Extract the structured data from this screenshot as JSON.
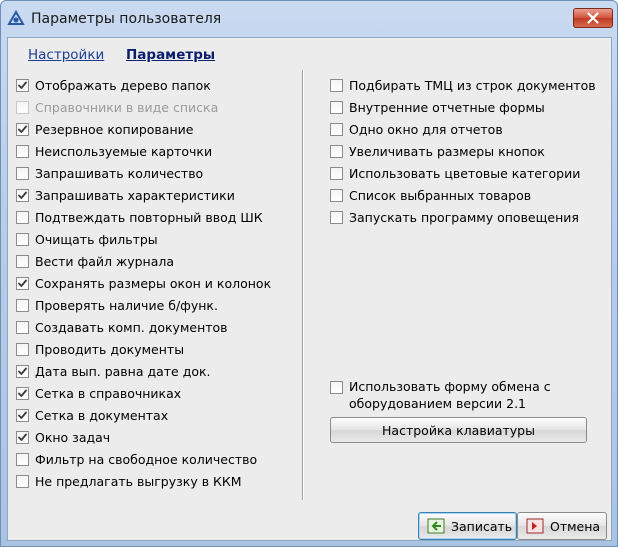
{
  "window": {
    "title": "Параметры пользователя",
    "icons": {
      "app": "app-logo-icon",
      "close": "close-icon"
    },
    "colors": {
      "close_button": "#c03a22",
      "link": "#1c3f94"
    }
  },
  "tabs": [
    {
      "label": "Настройки",
      "active": false
    },
    {
      "label": "Параметры",
      "active": true
    }
  ],
  "left_column": [
    {
      "label": "Отображать дерево папок",
      "checked": true,
      "enabled": true
    },
    {
      "label": "Справочники в виде списка",
      "checked": false,
      "enabled": false
    },
    {
      "label": "Резервное копирование",
      "checked": true,
      "enabled": true
    },
    {
      "label": "Неиспользуемые карточки",
      "checked": false,
      "enabled": true
    },
    {
      "label": "Запрашивать количество",
      "checked": false,
      "enabled": true
    },
    {
      "label": "Запрашивать характеристики",
      "checked": true,
      "enabled": true
    },
    {
      "label": "Подтвеждать повторный ввод ШК",
      "checked": false,
      "enabled": true
    },
    {
      "label": "Очищать фильтры",
      "checked": false,
      "enabled": true
    },
    {
      "label": "Вести файл журнала",
      "checked": false,
      "enabled": true
    },
    {
      "label": "Сохранять размеры окон и колонок",
      "checked": true,
      "enabled": true
    },
    {
      "label": "Проверять наличие б/функ.",
      "checked": false,
      "enabled": true
    },
    {
      "label": "Создавать комп. документов",
      "checked": false,
      "enabled": true
    },
    {
      "label": "Проводить документы",
      "checked": false,
      "enabled": true
    },
    {
      "label": "Дата вып. равна дате док.",
      "checked": true,
      "enabled": true
    },
    {
      "label": "Сетка в справочниках",
      "checked": true,
      "enabled": true
    },
    {
      "label": "Сетка в документах",
      "checked": true,
      "enabled": true
    },
    {
      "label": "Окно задач",
      "checked": true,
      "enabled": true
    },
    {
      "label": "Фильтр на свободное количество",
      "checked": false,
      "enabled": true
    },
    {
      "label": "Не предлагать выгрузку в ККМ",
      "checked": false,
      "enabled": true
    }
  ],
  "right_column": [
    {
      "label": "Подбирать ТМЦ из строк документов",
      "checked": false,
      "enabled": true
    },
    {
      "label": "Внутренние отчетные формы",
      "checked": false,
      "enabled": true
    },
    {
      "label": "Одно окно для отчетов",
      "checked": false,
      "enabled": true
    },
    {
      "label": "Увеличивать размеры кнопок",
      "checked": false,
      "enabled": true
    },
    {
      "label": "Использовать цветовые категории",
      "checked": false,
      "enabled": true
    },
    {
      "label": "Список выбранных товаров",
      "checked": false,
      "enabled": true
    },
    {
      "label": "Запускать программу оповещения",
      "checked": false,
      "enabled": true
    }
  ],
  "exchange_option": {
    "label": "Использовать форму обмена с оборудованием версии 2.1",
    "checked": false
  },
  "keyboard_button": {
    "label": "Настройка клавиатуры"
  },
  "footer": {
    "save_label": "Записать",
    "cancel_label": "Отмена",
    "icons": {
      "save": "save-icon",
      "cancel": "cancel-icon"
    }
  }
}
